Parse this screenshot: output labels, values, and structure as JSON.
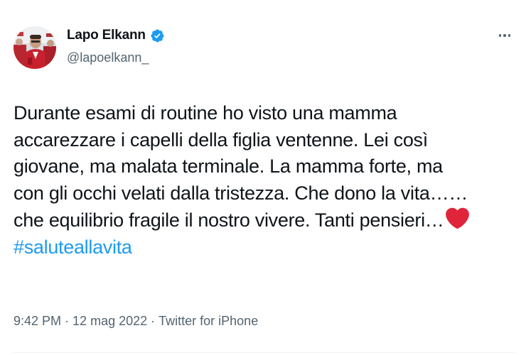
{
  "author": {
    "display_name": "Lapo Elkann",
    "handle": "@lapoelkann_",
    "verified": true
  },
  "tweet": {
    "lines": [
      "Durante esami di routine ho visto una mamma",
      "accarezzare i capelli della figlia ventenne. Lei così",
      "giovane, ma malata terminale. La mamma forte, ma",
      "con gli occhi velati dalla tristezza. Che dono la vita……",
      "che equilibrio fragile il nostro vivere. Tanti pensieri…"
    ],
    "emoji": "red-heart-icon",
    "hashtag": "#saluteallavita"
  },
  "meta": {
    "time": "9:42 PM",
    "separator": "·",
    "date": "12 mag 2022",
    "source": "Twitter for iPhone"
  },
  "colors": {
    "accent": "#1d9bf0",
    "text": "#0f1419",
    "secondary": "#536471",
    "heart": "#e0253a"
  }
}
